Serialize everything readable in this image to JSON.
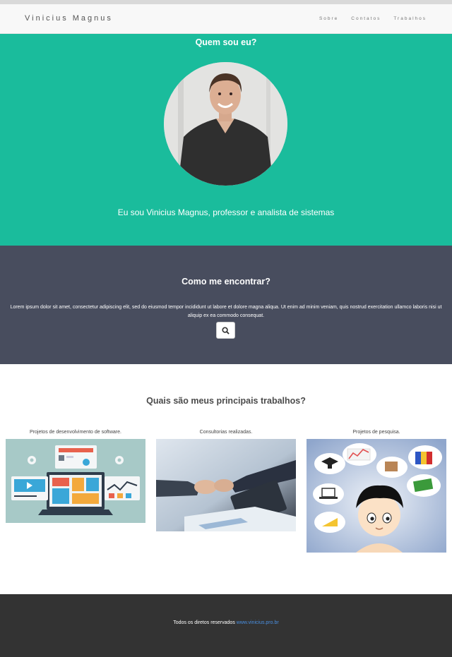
{
  "navbar": {
    "brand": "Vinicius Magnus",
    "links": [
      "Sobre",
      "Contatos",
      "Trabalhos"
    ]
  },
  "about": {
    "title": "Quem sou eu?",
    "text": "Eu sou Vinicius Magnus, professor e analista de sistemas"
  },
  "find": {
    "title": "Como me encontrar?",
    "text": "Lorem ipsum dolor sit amet, consectetur adipiscing elit, sed do eiusmod tempor incididunt ut labore et dolore magna aliqua. Ut enim ad minim veniam, quis nostrud exercitation ullamco laboris nisi ut aliquip ex ea commodo consequat.",
    "search_icon": "search-icon"
  },
  "works": {
    "title": "Quais são meus principais trabalhos?",
    "items": [
      {
        "label": "Projetos de desenvolvimento de software.",
        "image": "software-development-illustration"
      },
      {
        "label": "Consultorias realizadas.",
        "image": "handshake-photo"
      },
      {
        "label": "Projetos de pesquisa.",
        "image": "research-illustration"
      }
    ]
  },
  "footer": {
    "text": "Todos os diretos reservados",
    "link": "www.vinicius.pro.br"
  },
  "colors": {
    "teal": "#1abc9c",
    "slate": "#484d5e",
    "footer": "#333333",
    "link": "#4a90e2"
  }
}
